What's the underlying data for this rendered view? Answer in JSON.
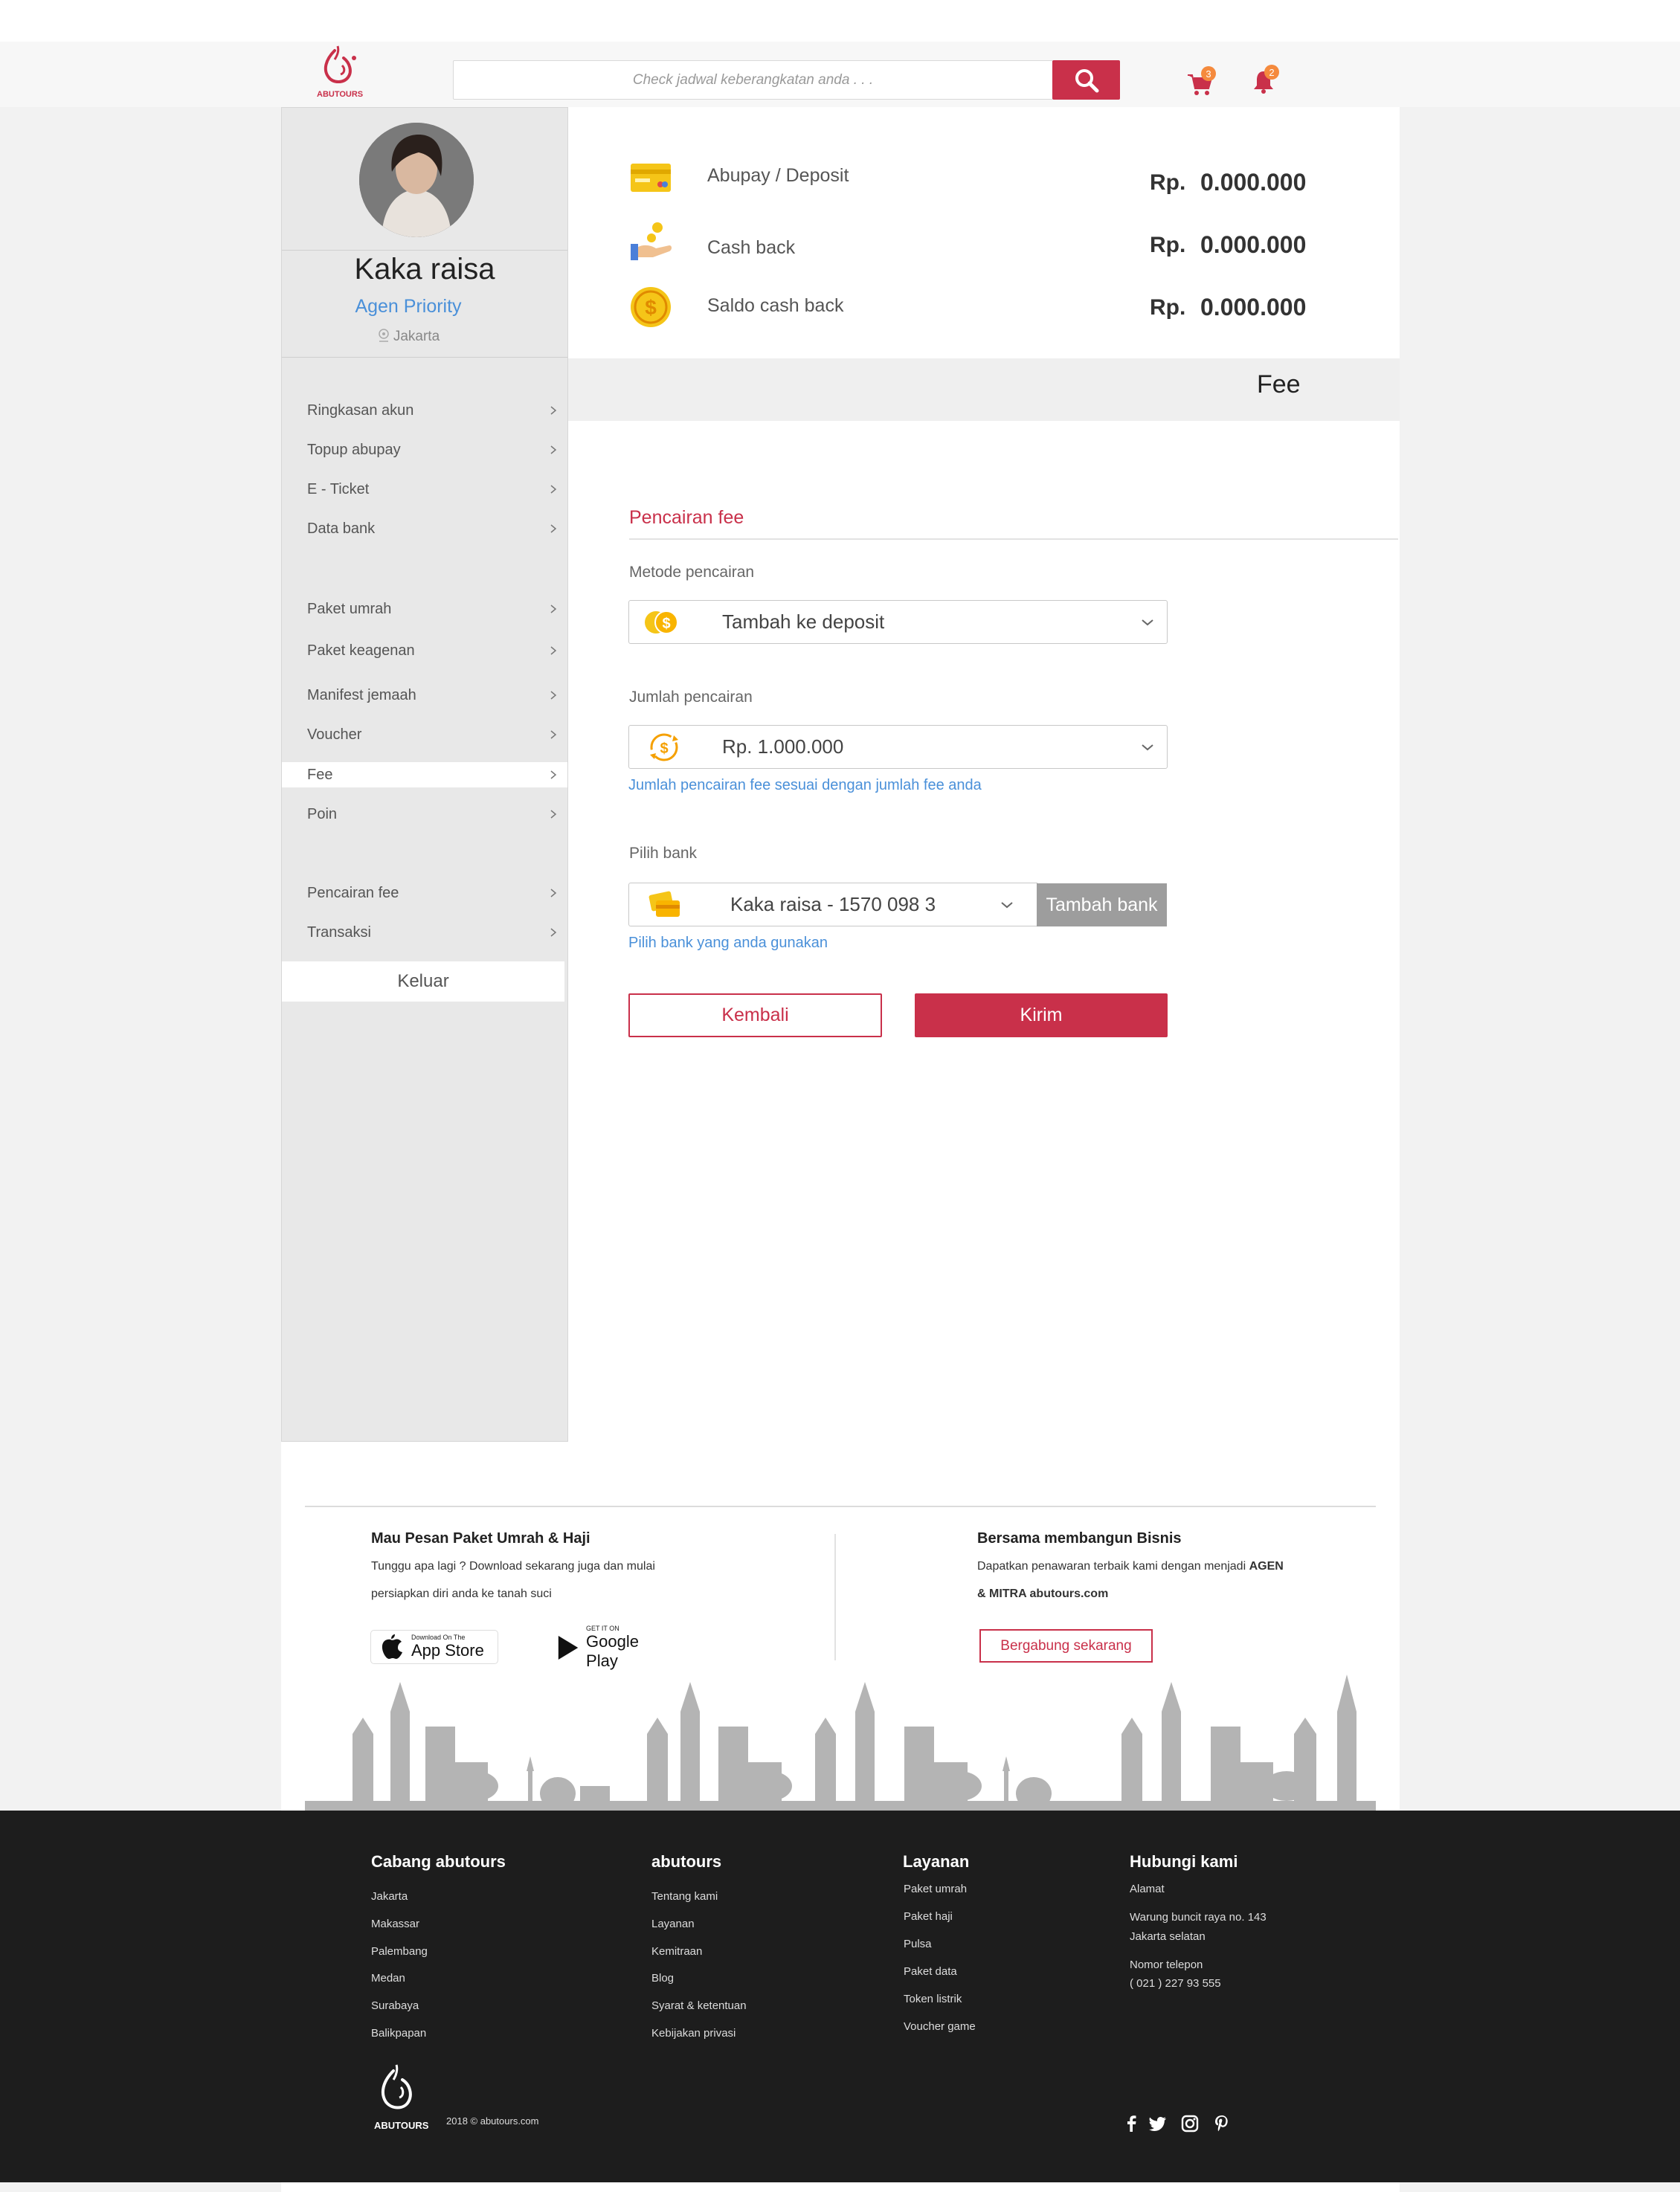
{
  "header": {
    "search_placeholder": "Check jadwal keberangkatan anda . . .",
    "cart_count": "3",
    "notif_count": "2",
    "logo_text": "ABUTOURS"
  },
  "profile": {
    "name": "Kaka raisa",
    "role": "Agen Priority",
    "location": "Jakarta"
  },
  "sidebar": {
    "items": [
      {
        "label": "Ringkasan akun"
      },
      {
        "label": "Topup abupay"
      },
      {
        "label": "E - Ticket"
      },
      {
        "label": "Data bank"
      },
      {
        "label": "Paket umrah"
      },
      {
        "label": "Paket keagenan"
      },
      {
        "label": "Manifest jemaah"
      },
      {
        "label": "Voucher"
      },
      {
        "label": "Fee"
      },
      {
        "label": "Poin"
      },
      {
        "label": "Pencairan fee"
      },
      {
        "label": "Transaksi"
      }
    ],
    "active": "Fee",
    "logout_label": "Keluar"
  },
  "balances": [
    {
      "label": "Abupay / Deposit",
      "currency": "Rp.",
      "value": "0.000.000",
      "icon": "card-icon"
    },
    {
      "label": "Cash back",
      "currency": "Rp.",
      "value": "0.000.000",
      "icon": "hand-coin-icon"
    },
    {
      "label": "Saldo cash back",
      "currency": "Rp.",
      "value": "0.000.000",
      "icon": "dollar-coin-icon"
    }
  ],
  "page_title": "Fee",
  "form": {
    "section_title": "Pencairan fee",
    "method_label": "Metode pencairan",
    "method_value": "Tambah ke deposit",
    "amount_label": "Jumlah pencairan",
    "amount_value": "Rp. 1.000.000",
    "amount_hint": "Jumlah pencairan fee sesuai dengan jumlah fee anda",
    "bank_label": "Pilih bank",
    "bank_value": "Kaka raisa - 1570 098 3",
    "bank_hint": "Pilih bank yang anda gunakan",
    "add_bank_label": "Tambah bank",
    "back_label": "Kembali",
    "submit_label": "Kirim"
  },
  "promo": {
    "left_title": "Mau Pesan Paket Umrah & Haji",
    "left_text_1": "Tunggu apa lagi ? Download sekarang juga dan mulai",
    "left_text_2": "persiapkan diri anda ke tanah suci",
    "appstore_small": "Download On The",
    "appstore_big": "App Store",
    "googleplay_small": "GET IT ON",
    "googleplay_big": "Google Play",
    "right_title": "Bersama membangun Bisnis",
    "right_text_1a": "Dapatkan penawaran terbaik kami dengan menjadi ",
    "right_text_1b": "AGEN",
    "right_text_2a": "& MITRA ",
    "right_text_2b": "abutours.com",
    "join_label": "Bergabung sekarang"
  },
  "footer": {
    "col1_title": "Cabang abutours",
    "col1_items": [
      "Jakarta",
      "Makassar",
      "Palembang",
      "Medan",
      "Surabaya",
      "Balikpapan"
    ],
    "col2_title": "abutours",
    "col2_items": [
      "Tentang kami",
      "Layanan",
      "Kemitraan",
      "Blog",
      "Syarat & ketentuan",
      "Kebijakan privasi"
    ],
    "col3_title": "Layanan",
    "col3_items": [
      "Paket umrah",
      "Paket haji",
      "Pulsa",
      "Paket data",
      "Token listrik",
      "Voucher game"
    ],
    "col4_title": "Hubungi kami",
    "address_label": "Alamat",
    "address_line1": "Warung buncit raya no. 143",
    "address_line2": "Jakarta selatan",
    "phone_label": "Nomor telepon",
    "phone_value": "( 021 )  227 93 555",
    "copyright": "2018 © abutours.com",
    "logo_text": "ABUTOURS"
  }
}
